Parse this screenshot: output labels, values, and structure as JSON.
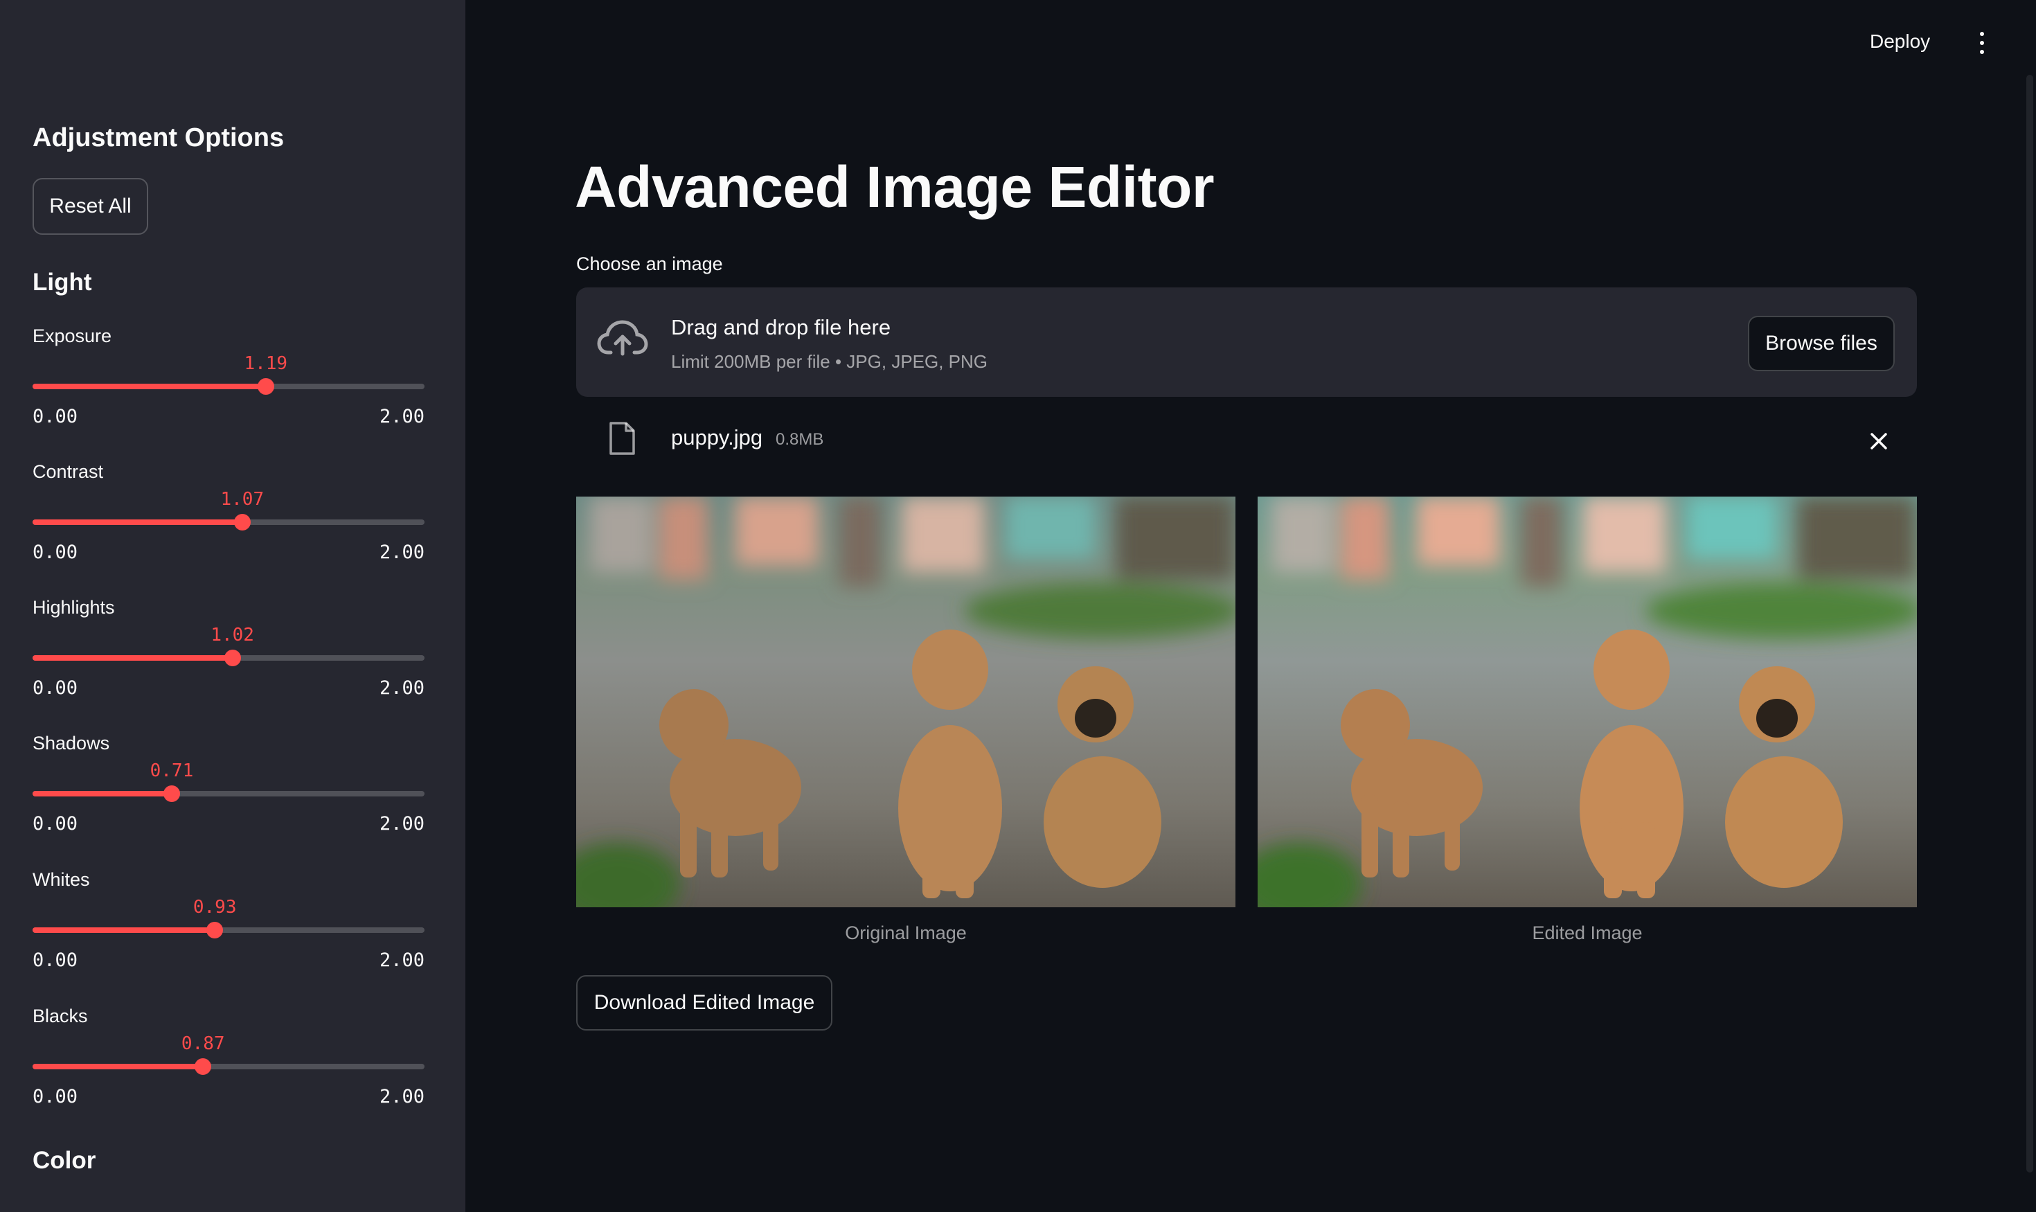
{
  "header": {
    "deploy_label": "Deploy",
    "menu_icon": "kebab-menu-icon"
  },
  "sidebar": {
    "title": "Adjustment Options",
    "reset_label": "Reset All",
    "light_header": "Light",
    "color_header": "Color",
    "sliders": [
      {
        "label": "Exposure",
        "value": "1.19",
        "min": "0.00",
        "max": "2.00",
        "num": 1.19
      },
      {
        "label": "Contrast",
        "value": "1.07",
        "min": "0.00",
        "max": "2.00",
        "num": 1.07
      },
      {
        "label": "Highlights",
        "value": "1.02",
        "min": "0.00",
        "max": "2.00",
        "num": 1.02
      },
      {
        "label": "Shadows",
        "value": "0.71",
        "min": "0.00",
        "max": "2.00",
        "num": 0.71
      },
      {
        "label": "Whites",
        "value": "0.93",
        "min": "0.00",
        "max": "2.00",
        "num": 0.93
      },
      {
        "label": "Blacks",
        "value": "0.87",
        "min": "0.00",
        "max": "2.00",
        "num": 0.87
      }
    ]
  },
  "main": {
    "title": "Advanced Image Editor",
    "uploader": {
      "label": "Choose an image",
      "drop_text": "Drag and drop file here",
      "limit_text": "Limit 200MB per file • JPG, JPEG, PNG",
      "browse_label": "Browse files"
    },
    "file": {
      "name": "puppy.jpg",
      "size": "0.8MB"
    },
    "images": {
      "original_caption": "Original Image",
      "edited_caption": "Edited Image"
    },
    "download_label": "Download Edited Image"
  },
  "colors": {
    "accent": "#ff4b4b",
    "background": "#0e1117",
    "sidebar": "#262730",
    "text": "#fafafa"
  }
}
